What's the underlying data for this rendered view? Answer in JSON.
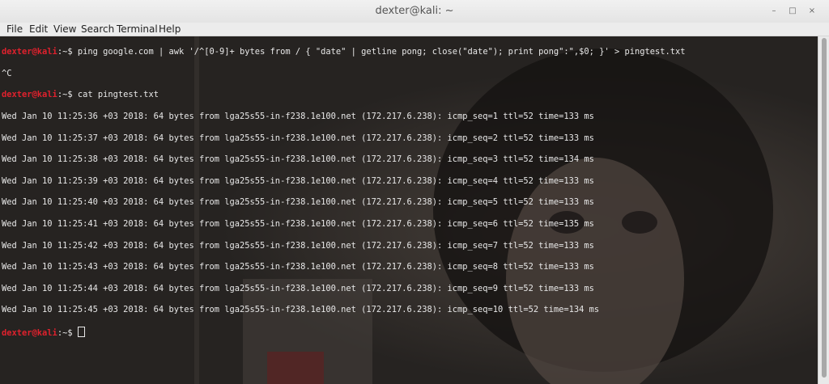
{
  "window": {
    "title": "dexter@kali: ~"
  },
  "titlebar_buttons": {
    "minimize": "–",
    "maximize": "□",
    "close": "×"
  },
  "menu": {
    "items": [
      "File",
      "Edit",
      "View",
      "Search",
      "Terminal",
      "Help"
    ]
  },
  "terminal": {
    "prompt_user": "dexter@kali",
    "prompt_path": ":~$ ",
    "cmd1": "ping google.com | awk '/^[0-9]+ bytes from / { \"date\" | getline pong; close(\"date\"); print pong\":\",$0; }' > pingtest.txt",
    "interrupt": "^C",
    "cmd2": "cat pingtest.txt",
    "output": [
      "Wed Jan 10 11:25:36 +03 2018: 64 bytes from lga25s55-in-f238.1e100.net (172.217.6.238): icmp_seq=1 ttl=52 time=133 ms",
      "Wed Jan 10 11:25:37 +03 2018: 64 bytes from lga25s55-in-f238.1e100.net (172.217.6.238): icmp_seq=2 ttl=52 time=133 ms",
      "Wed Jan 10 11:25:38 +03 2018: 64 bytes from lga25s55-in-f238.1e100.net (172.217.6.238): icmp_seq=3 ttl=52 time=134 ms",
      "Wed Jan 10 11:25:39 +03 2018: 64 bytes from lga25s55-in-f238.1e100.net (172.217.6.238): icmp_seq=4 ttl=52 time=133 ms",
      "Wed Jan 10 11:25:40 +03 2018: 64 bytes from lga25s55-in-f238.1e100.net (172.217.6.238): icmp_seq=5 ttl=52 time=133 ms",
      "Wed Jan 10 11:25:41 +03 2018: 64 bytes from lga25s55-in-f238.1e100.net (172.217.6.238): icmp_seq=6 ttl=52 time=135 ms",
      "Wed Jan 10 11:25:42 +03 2018: 64 bytes from lga25s55-in-f238.1e100.net (172.217.6.238): icmp_seq=7 ttl=52 time=133 ms",
      "Wed Jan 10 11:25:43 +03 2018: 64 bytes from lga25s55-in-f238.1e100.net (172.217.6.238): icmp_seq=8 ttl=52 time=133 ms",
      "Wed Jan 10 11:25:44 +03 2018: 64 bytes from lga25s55-in-f238.1e100.net (172.217.6.238): icmp_seq=9 ttl=52 time=133 ms",
      "Wed Jan 10 11:25:45 +03 2018: 64 bytes from lga25s55-in-f238.1e100.net (172.217.6.238): icmp_seq=10 ttl=52 time=134 ms"
    ]
  },
  "colors": {
    "prompt_user": "#e0212d",
    "text": "#e8e8e8",
    "background": "#262321"
  }
}
